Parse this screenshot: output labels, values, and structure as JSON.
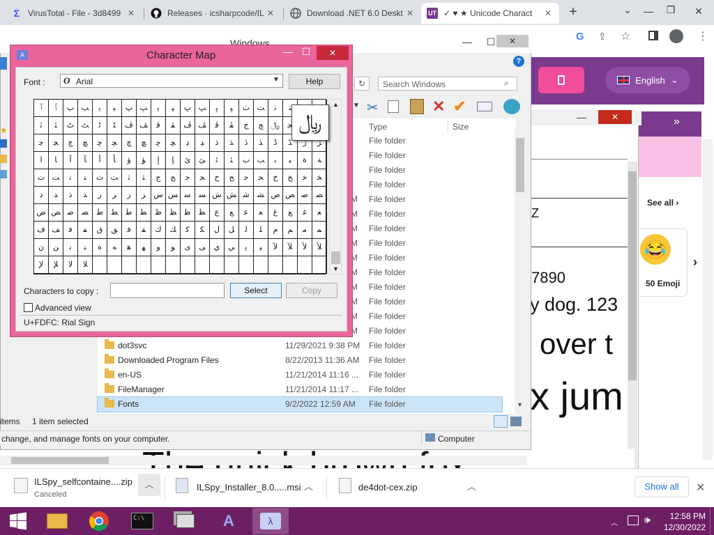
{
  "browser": {
    "tabs": [
      {
        "title": "VirusTotal - File - 3d8499",
        "icon": "virustotal-icon",
        "color": "#394eff"
      },
      {
        "title": "Releases · icsharpcode/IL",
        "icon": "github-icon",
        "color": "#111111"
      },
      {
        "title": "Download .NET 6.0 Deskt",
        "icon": "globe-icon",
        "color": "#555555"
      },
      {
        "title": "✓ ♥ ★ Unicode Charact",
        "icon": "ut-icon",
        "color": "#7a3b8f"
      }
    ],
    "new_tab": "+",
    "tab_menu": "⌄"
  },
  "webpage": {
    "language_label": "English",
    "menu_glyph": "»",
    "see_all": "See all",
    "emoji_label": "50 Emoji",
    "preview_lines": [
      "Z",
      "7890",
      "y dog. 123",
      "over t",
      "x jum",
      "The quick brown fox"
    ]
  },
  "explorer": {
    "title": "Windows",
    "search_placeholder": "Search Windows",
    "col_type": "Type",
    "col_size": "Size",
    "rows": [
      {
        "name": "",
        "date": "",
        "type": "File folder",
        "date_frag": ""
      },
      {
        "name": "",
        "date": "",
        "type": "File folder",
        "date_frag": ""
      },
      {
        "name": "",
        "date": "",
        "type": "File folder",
        "date_frag": ""
      },
      {
        "name": "",
        "date": "",
        "type": "File folder",
        "date_frag": ""
      },
      {
        "name": "",
        "date": "",
        "type": "File folder",
        "date_frag": "M"
      },
      {
        "name": "",
        "date": "",
        "type": "File folder",
        "date_frag": "M"
      },
      {
        "name": "",
        "date": "",
        "type": "File folder",
        "date_frag": "M"
      },
      {
        "name": "",
        "date": "",
        "type": "File folder",
        "date_frag": "M"
      },
      {
        "name": "",
        "date": "",
        "type": "File folder",
        "date_frag": "M"
      },
      {
        "name": "",
        "date": "",
        "type": "File folder",
        "date_frag": "M"
      },
      {
        "name": "",
        "date": "",
        "type": "File folder",
        "date_frag": "M"
      },
      {
        "name": "",
        "date": "",
        "type": "File folder",
        "date_frag": "M"
      },
      {
        "name": "",
        "date": "",
        "type": "File folder",
        "date_frag": "M"
      },
      {
        "name": "",
        "date": "",
        "type": "File folder",
        "date_frag": "M"
      },
      {
        "name": "dot3svc",
        "date": "11/29/2021 9:38 PM",
        "type": "File folder"
      },
      {
        "name": "Downloaded Program Files",
        "date": "8/22/2013 11:36 AM",
        "type": "File folder"
      },
      {
        "name": "en-US",
        "date": "11/21/2014 11:16 ...",
        "type": "File folder"
      },
      {
        "name": "FileManager",
        "date": "11/21/2014 11:17 ...",
        "type": "File folder"
      },
      {
        "name": "Fonts",
        "date": "9/2/2022 12:59 AM",
        "type": "File folder"
      }
    ],
    "status_items": "items",
    "status_selected": "1 item selected",
    "bottom_desc": "change, and manage fonts on your computer.",
    "bottom_location": "Computer"
  },
  "charmap": {
    "title": "Character Map",
    "font_label": "Font :",
    "font_value": "Arial",
    "help": "Help",
    "copy_label": "Characters to copy :",
    "copy_value": "",
    "select": "Select",
    "copy": "Copy",
    "advanced": "Advanced view",
    "status": "U+FDFC: Rial Sign",
    "zoom_char": "﷼",
    "grid": [
      [
        "ﭐ",
        "ﭑ",
        "ﭒ",
        "ﭓ",
        "ﭔ",
        "ﭕ",
        "ﭖ",
        "ﭗ",
        "ﭘ",
        "ﭙ",
        "ﭚ",
        "ﭛ",
        "ﭜ",
        "ﭝ",
        "ﭞ",
        "ﭟ",
        "ﭠ",
        "ﭡ",
        "ﭢ",
        "ﭣ"
      ],
      [
        "ﭤ",
        "ﭥ",
        "ﭦ",
        "ﭧ",
        "ﭨ",
        "ﭩ",
        "ﭪ",
        "ﭫ",
        "ﭬ",
        "ﭭ",
        "ﭮ",
        "ﭯ",
        "ﭰ",
        "ﭱ",
        "ﭲ",
        "ﭳ",
        "﷼",
        "ﭵ",
        "ﭶ",
        "ﭷ"
      ],
      [
        "ﭸ",
        "ﭹ",
        "ﭺ",
        "ﭻ",
        "ﭼ",
        "ﭽ",
        "ﭾ",
        "ﭿ",
        "ﮀ",
        "ﮁ",
        "ﮂ",
        "ﮃ",
        "ﮄ",
        "ﮅ",
        "ﮆ",
        "ﮇ",
        "ﮈ",
        "ﮉ",
        "ﮊ",
        "ﮋ"
      ],
      [
        "ا",
        "ﺎ",
        "آ",
        "ﺂ",
        "أ",
        "ﺄ",
        "ؤ",
        "ﺆ",
        "إ",
        "ﺈ",
        "ئ",
        "ﺊ",
        "ﺋ",
        "ﺌ",
        "ب",
        "ﺐ",
        "ﺑ",
        "ﺒ",
        "ة",
        "ﺔ"
      ],
      [
        "ت",
        "ﺖ",
        "ﺗ",
        "ﺘ",
        "ث",
        "ﺚ",
        "ﺛ",
        "ﺜ",
        "ج",
        "ﺞ",
        "ﺟ",
        "ﺠ",
        "ح",
        "ﺢ",
        "ﺣ",
        "ﺤ",
        "خ",
        "ﺦ",
        "ﺧ",
        "ﺨ"
      ],
      [
        "د",
        "ﺪ",
        "ذ",
        "ﺬ",
        "ر",
        "ﺮ",
        "ز",
        "ﺰ",
        "س",
        "ﺲ",
        "ﺳ",
        "ﺴ",
        "ش",
        "ﺶ",
        "ﺷ",
        "ﺸ",
        "ص",
        "ﺺ",
        "ﺻ",
        "ﺼ"
      ],
      [
        "ض",
        "ﺾ",
        "ﺿ",
        "ﻀ",
        "ط",
        "ﻂ",
        "ﻃ",
        "ﻄ",
        "ظ",
        "ﻆ",
        "ﻇ",
        "ﻈ",
        "ع",
        "ﻊ",
        "ﻋ",
        "ﻌ",
        "غ",
        "ﻎ",
        "ﻏ",
        "ﻐ"
      ],
      [
        "ف",
        "ﻒ",
        "ﻓ",
        "ﻔ",
        "ق",
        "ﻖ",
        "ﻗ",
        "ﻘ",
        "ك",
        "ﻚ",
        "ﻛ",
        "ﻜ",
        "ل",
        "ﻞ",
        "ﻟ",
        "ﻠ",
        "م",
        "ﻢ",
        "ﻣ",
        "ﻤ"
      ],
      [
        "ن",
        "ﻦ",
        "ﻧ",
        "ﻨ",
        "ه",
        "ﻪ",
        "ﻫ",
        "ﻬ",
        "و",
        "ﻮ",
        "ى",
        "ﻰ",
        "ي",
        "ﻲ",
        "ﻳ",
        "ﻴ",
        "ﻵ",
        "ﻶ",
        "ﻷ",
        "ﻸ"
      ],
      [
        "ﻹ",
        "ﻺ",
        "ﻻ",
        "ﻼ",
        "﻿",
        "",
        "",
        "",
        "",
        "",
        "",
        "",
        "",
        "",
        "",
        "",
        "",
        "",
        "",
        ""
      ]
    ]
  },
  "downloads": {
    "items": [
      {
        "name": "ILSpy_selfcontaine....zip",
        "sub": "Canceled"
      },
      {
        "name": "ILSpy_Installer_8.0.....msi",
        "sub": ""
      },
      {
        "name": "de4dot-cex.zip",
        "sub": ""
      }
    ],
    "show_all": "Show all"
  },
  "taskbar": {
    "time": "12:58 PM",
    "date": "12/30/2022"
  }
}
